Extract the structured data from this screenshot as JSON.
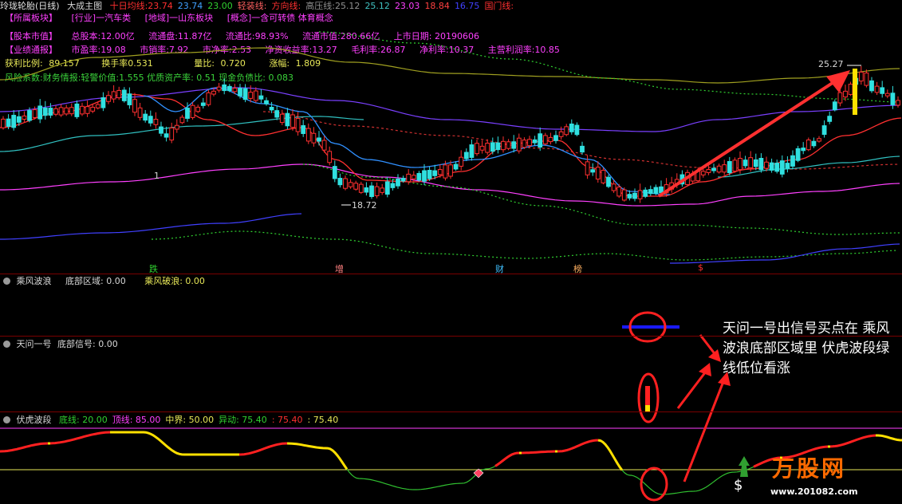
{
  "header": {
    "title": "玲珑轮胎(日线)",
    "indicator": "大成主图",
    "items": [
      {
        "label": "十日均线:",
        "value": "23.74",
        "color": "#ff3030"
      },
      {
        "label": "",
        "value": "23.74",
        "color": "#40a0ff"
      },
      {
        "label": "",
        "value": "23.00",
        "color": "#30d030"
      },
      {
        "label": "轻装线:",
        "value": "",
        "color": "#ff6060"
      },
      {
        "label": "方向线:",
        "value": "",
        "color": "#ff3030"
      },
      {
        "label": "高压线:",
        "value": "25.12",
        "color": "#909090"
      },
      {
        "label": "",
        "value": "25.12",
        "color": "#40c0c0"
      },
      {
        "label": "",
        "value": "23.03",
        "color": "#ff40ff"
      },
      {
        "label": "",
        "value": "18.84",
        "color": "#ff4040"
      },
      {
        "label": "",
        "value": "16.75",
        "color": "#4040ff"
      },
      {
        "label": "国门线:",
        "value": "",
        "color": "#ff3030"
      }
    ]
  },
  "info": {
    "row1": [
      "【所属板块】",
      "[行业]一汽车类",
      "[地域]一山东板块",
      "[概念]一含可转债 体育概念"
    ],
    "row2": [
      "【股本市值】",
      "总股本:12.00亿",
      "流通盘:11.87亿",
      "流通比:98.93%",
      "流通市值:280.66亿",
      "上市日期: 20190606"
    ],
    "row3": [
      "【业绩通报】",
      "市盈率:19.08",
      "市销率:7.92",
      "市净率:2.53",
      "净资收益率:13.27",
      "毛利率:26.87",
      "净利率:10.37",
      "主营利润率:10.85"
    ],
    "row4": [
      {
        "label": "获利比例:",
        "value": "89.157"
      },
      {
        "label": "换手率",
        "value": "0.531"
      },
      {
        "label": "量比:",
        "value": "0.720"
      },
      {
        "label": "涨幅:",
        "value": "1.809"
      }
    ],
    "row5": "风险系数:财务情报:轻警价值:1.555 优质资产率: 0.51 现金负债比: 0.083"
  },
  "chart_labels": {
    "high": "25.27",
    "low": "18.72",
    "low_left": "1",
    "signals": [
      "跌",
      "增",
      "财",
      "榜",
      "$"
    ]
  },
  "panels": {
    "p1": {
      "title": "乘风波浪",
      "line1": "底部区域: 0.00",
      "line2": "乘风破浪: 0.00"
    },
    "p2": {
      "title": "天问一号",
      "line1": "底部信号: 0.00"
    },
    "p3": {
      "title": "伏虎波段",
      "items": [
        {
          "label": "底线:",
          "value": "20.00",
          "color": "#30d030"
        },
        {
          "label": "顶线:",
          "value": "85.00",
          "color": "#ff40ff"
        },
        {
          "label": "中界:",
          "value": "50.00",
          "color": "#e8e858"
        },
        {
          "label": "异动:",
          "value": "75.40",
          "color": "#30d030"
        },
        {
          "label": ":",
          "value": "75.40",
          "color": "#ff3030"
        },
        {
          "label": ":",
          "value": "75.40",
          "color": "#e8e858"
        }
      ]
    }
  },
  "annotation": "天问一号出信号买点在 乘风波浪底部区域里 伏虎波段绿线低位看涨",
  "watermark": {
    "brand": "万股网",
    "url": "www.201082.com"
  }
}
